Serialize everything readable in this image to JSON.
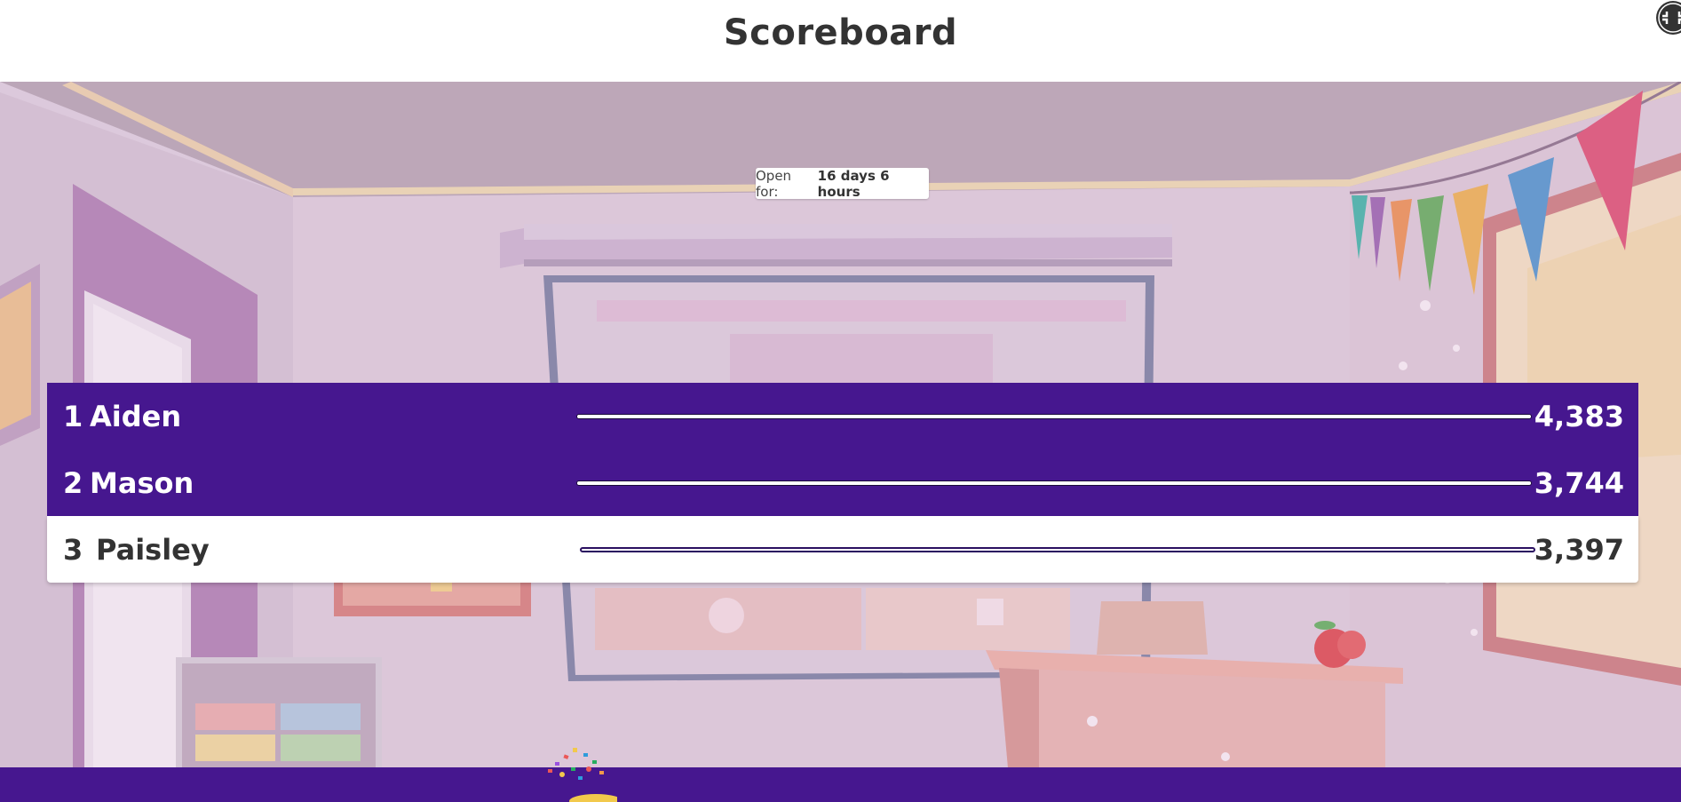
{
  "header": {
    "title": "Scoreboard"
  },
  "timer": {
    "label": "Open for:",
    "value": "16 days 6 hours"
  },
  "scoreboard": [
    {
      "rank": "1",
      "name": "Aiden",
      "score": "4,383",
      "highlighted": false,
      "bar_fraction": 1.0
    },
    {
      "rank": "2",
      "name": "Mason",
      "score": "3,744",
      "highlighted": false,
      "bar_fraction": 1.0
    },
    {
      "rank": "3",
      "name": "Paisley",
      "score": "3,397",
      "highlighted": true,
      "bar_fraction": 1.0
    }
  ],
  "icons": {
    "fullscreen": "exit-fullscreen-icon",
    "footer": "confetti-icon"
  },
  "colors": {
    "accent": "#46178f",
    "background": "#ffffff",
    "text": "#333333"
  }
}
